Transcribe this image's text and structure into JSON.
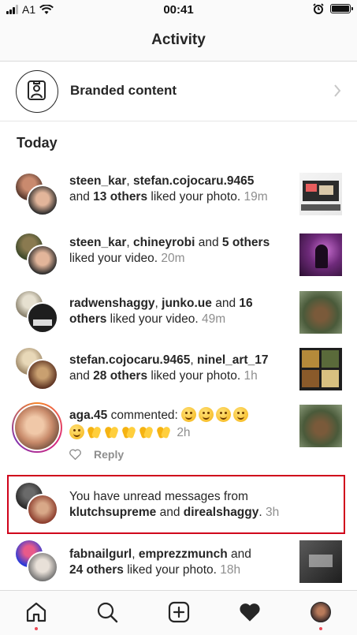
{
  "status_bar": {
    "carrier": "A1",
    "time": "00:41"
  },
  "header": {
    "title": "Activity"
  },
  "branded": {
    "label": "Branded content"
  },
  "section": {
    "title": "Today"
  },
  "notifications": [
    {
      "user1": "steen_kar",
      "sep1": ", ",
      "user2": "stefan.cojocaru.9465",
      "pre": "and ",
      "others": "13 others",
      "post": " liked your photo.",
      "time": "19m"
    },
    {
      "user1": "steen_kar",
      "sep1": ", ",
      "user2": "chineyrobi",
      "pre": " and ",
      "others": "5 others",
      "post": " liked your video.",
      "time": "20m"
    },
    {
      "user1": "radwenshaggy",
      "sep1": ", ",
      "user2": "junko.ue",
      "pre": " and ",
      "others": "16 others",
      "post": " liked your video.",
      "time": "49m"
    },
    {
      "user1": "stefan.cojocaru.9465",
      "sep1": ", ",
      "user2": "ninel_art_17",
      "pre": "and ",
      "others": "28 others",
      "post": " liked your photo.",
      "time": "1h"
    }
  ],
  "comment": {
    "user": "aga.45",
    "text": " commented: ",
    "time": "2h",
    "reply": "Reply"
  },
  "message": {
    "text": "You have unread messages from",
    "user1": "klutchsupreme",
    "conj": " and ",
    "user2": "direalshaggy",
    "period": ".",
    "time": "3h"
  },
  "last": {
    "user1": "fabnailgurl",
    "sep1": ", ",
    "user2": "emprezzmunch",
    "pre": " and",
    "others": "24 others",
    "post": " liked your photo.",
    "time": "18h"
  },
  "tabs": [
    "home-icon",
    "search-icon",
    "new-post-icon",
    "activity-heart-icon",
    "profile-avatar"
  ],
  "colors": {
    "text": "#262626",
    "secondary": "#8e8e8e",
    "notification_dot": "#ed4956",
    "highlight": "#d0021b"
  }
}
